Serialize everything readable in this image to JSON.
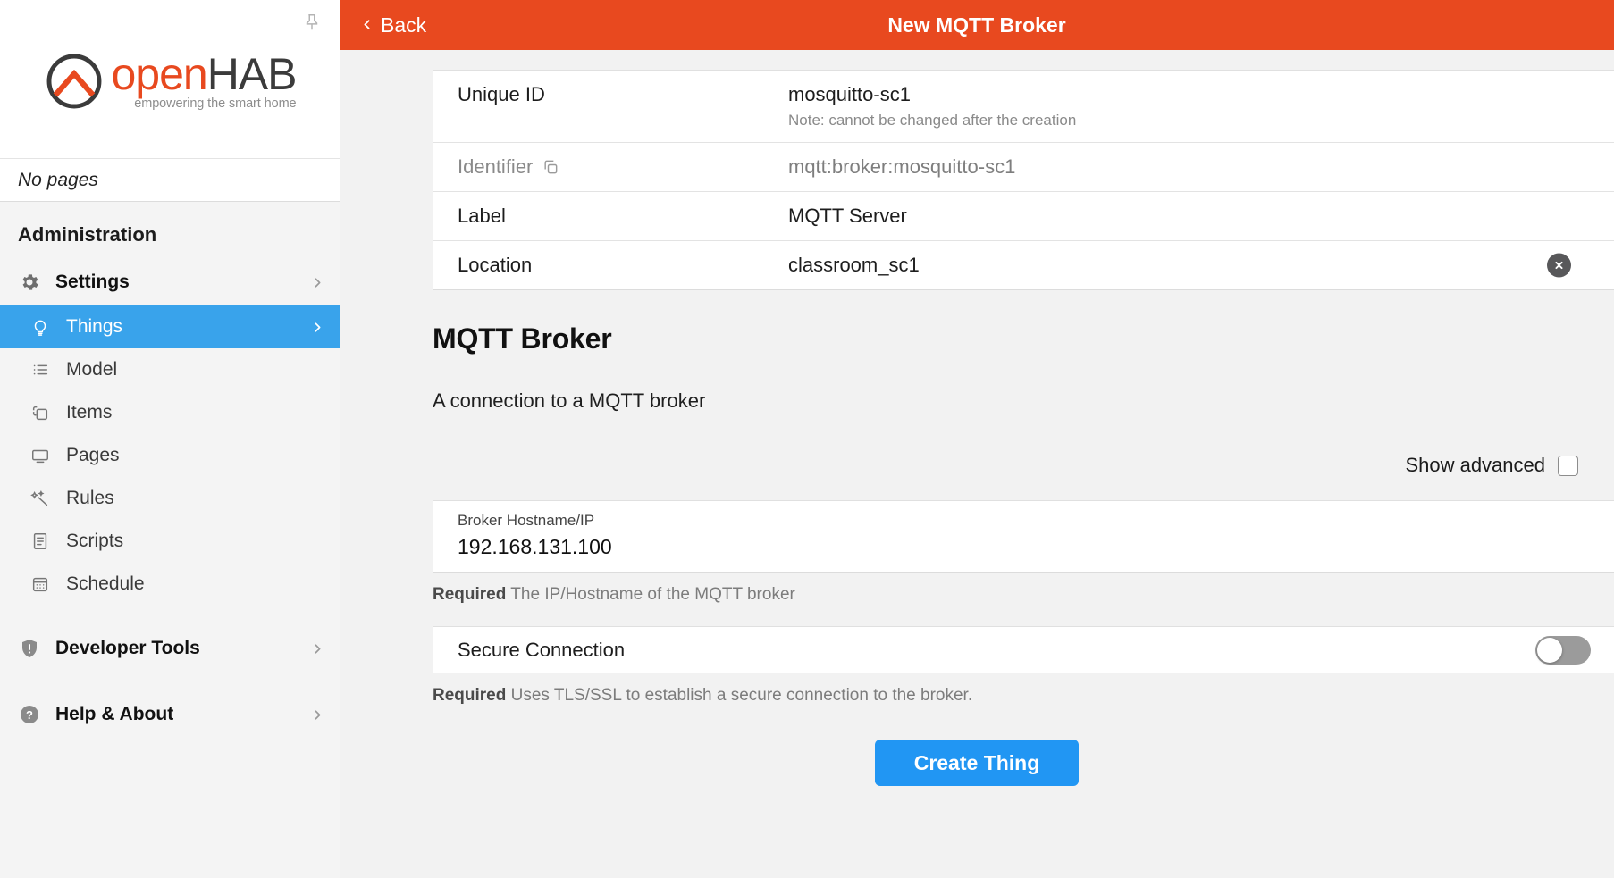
{
  "sidebar": {
    "pin_icon": "pin-icon",
    "logo": {
      "word_open": "open",
      "word_hab": "HAB",
      "tagline": "empowering the smart home"
    },
    "no_pages": "No pages",
    "section_title": "Administration",
    "items": [
      {
        "label": "Settings",
        "icon": "gear-icon",
        "level": "top",
        "chevron": true,
        "active": false
      },
      {
        "label": "Things",
        "icon": "bulb-icon",
        "level": "sub",
        "chevron": true,
        "active": true
      },
      {
        "label": "Model",
        "icon": "list-icon",
        "level": "sub",
        "chevron": false,
        "active": false
      },
      {
        "label": "Items",
        "icon": "layers-icon",
        "level": "sub",
        "chevron": false,
        "active": false
      },
      {
        "label": "Pages",
        "icon": "monitor-icon",
        "level": "sub",
        "chevron": false,
        "active": false
      },
      {
        "label": "Rules",
        "icon": "wand-icon",
        "level": "sub",
        "chevron": false,
        "active": false
      },
      {
        "label": "Scripts",
        "icon": "document-icon",
        "level": "sub",
        "chevron": false,
        "active": false
      },
      {
        "label": "Schedule",
        "icon": "calendar-icon",
        "level": "sub",
        "chevron": false,
        "active": false
      },
      {
        "label": "Developer Tools",
        "icon": "shield-icon",
        "level": "top",
        "chevron": true,
        "active": false
      },
      {
        "label": "Help & About",
        "icon": "question-icon",
        "level": "top",
        "chevron": true,
        "active": false
      }
    ]
  },
  "topbar": {
    "back_label": "Back",
    "back_icon": "chevron-left-icon",
    "title": "New MQTT Broker",
    "accent_color": "#e8491f"
  },
  "form": {
    "rows": [
      {
        "label": "Unique ID",
        "value": "mosquitto-sc1",
        "note": "Note: cannot be changed after the creation",
        "muted_label": false,
        "muted_value": false,
        "copy_icon": false,
        "clear_icon": false
      },
      {
        "label": "Identifier",
        "value": "mqtt:broker:mosquitto-sc1",
        "note": "",
        "muted_label": true,
        "muted_value": true,
        "copy_icon": true,
        "clear_icon": false
      },
      {
        "label": "Label",
        "value": "MQTT Server",
        "note": "",
        "muted_label": false,
        "muted_value": false,
        "copy_icon": false,
        "clear_icon": false
      },
      {
        "label": "Location",
        "value": "classroom_sc1",
        "note": "",
        "muted_label": false,
        "muted_value": false,
        "copy_icon": false,
        "clear_icon": true
      }
    ]
  },
  "thing_type": {
    "title": "MQTT Broker",
    "description": "A connection to a MQTT broker"
  },
  "advanced": {
    "label": "Show advanced",
    "checked": false
  },
  "config": {
    "hostname": {
      "title": "Broker Hostname/IP",
      "value": "192.168.131.100",
      "required_label": "Required",
      "helper": "The IP/Hostname of the MQTT broker"
    },
    "secure": {
      "label": "Secure Connection",
      "enabled": false,
      "required_label": "Required",
      "helper": "Uses TLS/SSL to establish a secure connection to the broker."
    }
  },
  "submit": {
    "label": "Create Thing",
    "color": "#2196f3"
  }
}
